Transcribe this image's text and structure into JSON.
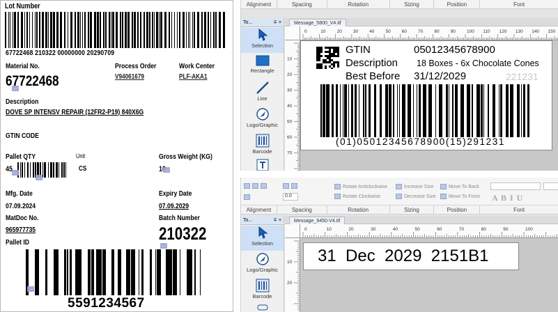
{
  "label": {
    "lot_title": "Lot Number",
    "lot_text": "67722468 210322 00000000 20290709",
    "material_label": "Material No.",
    "material_value": "67722468",
    "material_tag": "...",
    "process_order_label": "Process Order",
    "process_order_value": "V94061679",
    "work_center_label": "Work Center",
    "work_center_value": "PLF-AKA1",
    "description_label": "Description",
    "description_value": "DOVE SP INTENSV REPAIR (12FR2-P19) 840X6G",
    "gtin_label": "GTIN CODE",
    "pallet_qty_label": "Pallet QTY",
    "pallet_qty_value": "45",
    "pallet_qty_tag": "...",
    "pallet_qty_tag2": "...",
    "unit_label": "Unit",
    "unit_value": "CS",
    "gross_weight_label": "Gross Weight (KG)",
    "gross_weight_value": "10",
    "gross_weight_tag": "...",
    "mfg_label": "Mfg. Date",
    "mfg_value": "07.09.2024",
    "expiry_label": "Expiry Date",
    "expiry_value": "07.09.2029",
    "matdoc_label": "MatDoc No.",
    "matdoc_value": "965977735",
    "batch_label": "Batch Number",
    "batch_value": "210322",
    "batch_tag": "...",
    "pallet_id_label": "Pallet ID",
    "pallet_id_value": "5591234567",
    "pallet_id_tag": "..."
  },
  "editor1": {
    "ribbon_groups": [
      "Alignment",
      "Spacing",
      "Rotation",
      "Sizing",
      "Position",
      "Font"
    ],
    "panel_tab": "To...",
    "panel_pin": "∓",
    "panel_close": "×",
    "doc_tab": "Message_5800_V4.itf",
    "tools": [
      "Selection",
      "Rectangle",
      "Line",
      "Logo/Graphic",
      "Barcode"
    ],
    "ruler_ticks": [
      "0",
      "10",
      "20",
      "30",
      "40",
      "50",
      "60",
      "70",
      "80",
      "90",
      "100",
      "110",
      "120",
      "130",
      "140",
      "150"
    ],
    "vruler_ticks": [
      "10",
      "20",
      "30",
      "40",
      "50",
      "60",
      "70"
    ],
    "gtin_key": "GTIN",
    "gtin_val": "05012345678900",
    "desc_key": "Description",
    "desc_val": "18 Boxes - 6x Chocolate Cones",
    "bb_key": "Best Before",
    "bb_val": "31/12/2029",
    "bb_faint": "221231",
    "barcode_text": "(01)05012345678900(15)291231"
  },
  "editor2": {
    "tool_items": [
      "Rotate Anticlockwise",
      "Rotate Clockwise",
      "Increase Size",
      "Decrease Size",
      "Move To Back",
      "Move To Front"
    ],
    "spacing_value": "0.0",
    "font_glyphs": "A B I U",
    "ribbon_groups": [
      "Alignment",
      "Spacing",
      "Rotation",
      "Sizing",
      "Position",
      "Font"
    ],
    "panel_tab": "To...",
    "panel_pin": "∓",
    "panel_close": "×",
    "doc_tab": "Message_9450-V4.itf",
    "tools": [
      "Selection",
      "Logo/Graphic",
      "Barcode"
    ],
    "ruler_ticks": [
      "0",
      "10",
      "20",
      "30",
      "40",
      "50",
      "60",
      "70",
      "80",
      "90",
      "100"
    ],
    "vruler_ticks": [
      "10",
      "20"
    ],
    "big_text": "31  Dec  2029  2151B1"
  }
}
